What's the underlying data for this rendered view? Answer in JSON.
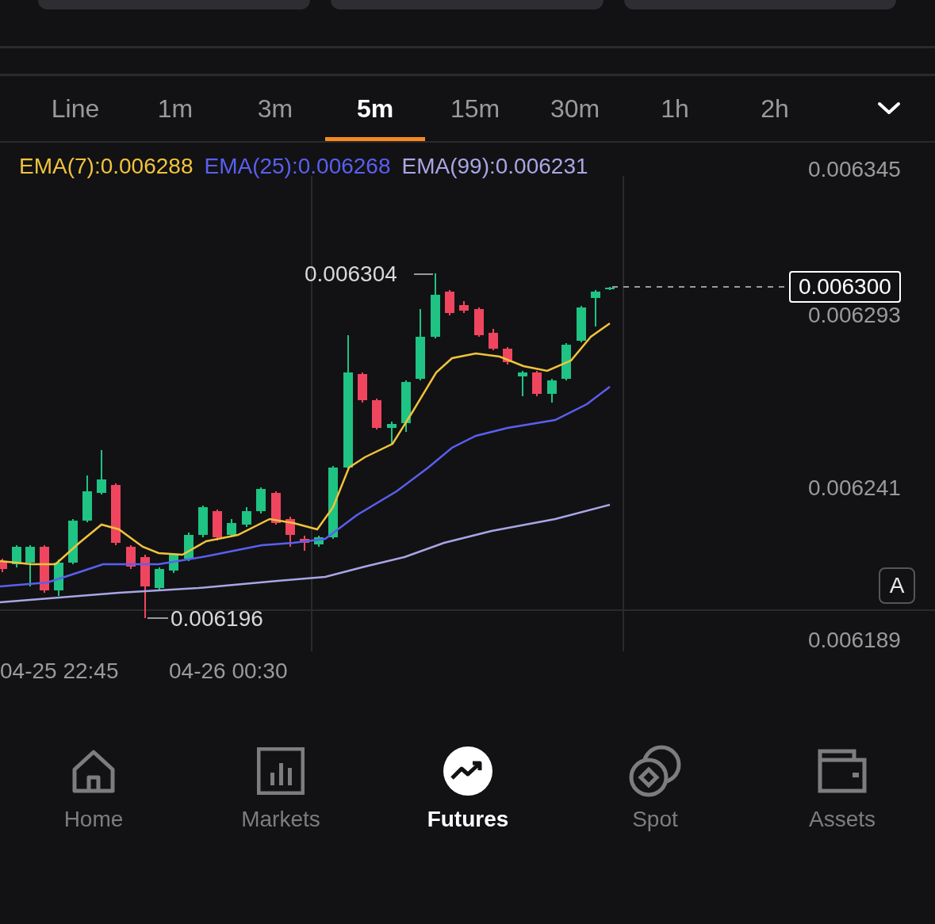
{
  "tabs": [
    {
      "label": "Line",
      "selected": false
    },
    {
      "label": "1m",
      "selected": false
    },
    {
      "label": "3m",
      "selected": false
    },
    {
      "label": "5m",
      "selected": true
    },
    {
      "label": "15m",
      "selected": false
    },
    {
      "label": "30m",
      "selected": false
    },
    {
      "label": "1h",
      "selected": false
    },
    {
      "label": "2h",
      "selected": false
    }
  ],
  "chart": {
    "indicators": [
      {
        "label": "EMA(7):0.006288",
        "color": "#f0c33c"
      },
      {
        "label": "EMA(25):0.006268",
        "color": "#5b5ff0"
      },
      {
        "label": "EMA(99):0.006231",
        "color": "#a9a6e6"
      }
    ],
    "y_axis": [
      "0.006345",
      "0.006293",
      "0.006241",
      "0.006189"
    ],
    "x_axis": [
      "04-25 22:45",
      "04-26 00:30"
    ],
    "high_label": "0.006304",
    "low_label": "0.006196",
    "last_price": "0.006300",
    "auto_button": "A"
  },
  "nav": [
    {
      "label": "Home",
      "selected": false
    },
    {
      "label": "Markets",
      "selected": false
    },
    {
      "label": "Futures",
      "selected": true
    },
    {
      "label": "Spot",
      "selected": false
    },
    {
      "label": "Assets",
      "selected": false
    }
  ]
}
